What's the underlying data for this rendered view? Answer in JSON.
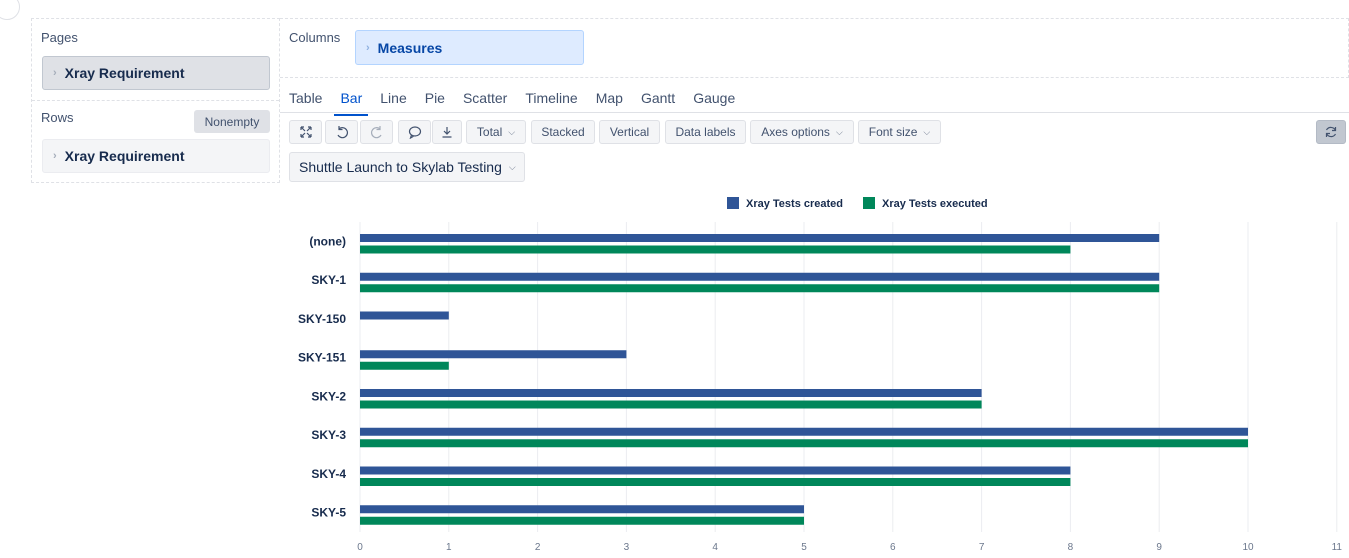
{
  "left_panel": {
    "pages_label": "Pages",
    "pages_pill": "Xray Requirement",
    "rows_label": "Rows",
    "nonempty_label": "Nonempty",
    "rows_pill": "Xray Requirement"
  },
  "columns_panel": {
    "label": "Columns",
    "pill": "Measures"
  },
  "tabs": [
    "Table",
    "Bar",
    "Line",
    "Pie",
    "Scatter",
    "Timeline",
    "Map",
    "Gantt",
    "Gauge"
  ],
  "active_tab": "Bar",
  "toolbar": {
    "total": "Total",
    "stacked": "Stacked",
    "vertical": "Vertical",
    "data_labels": "Data labels",
    "axes_options": "Axes options",
    "font_size": "Font size",
    "icons": [
      "expand-icon",
      "undo-icon",
      "redo-icon",
      "comment-icon",
      "download-icon",
      "refresh-icon"
    ]
  },
  "page_select": "Shuttle Launch to Skylab Testing",
  "colors": {
    "created": "#2f5597",
    "executed": "#00875a",
    "accent": "#0052cc"
  },
  "chart_data": {
    "type": "bar",
    "orientation": "horizontal",
    "categories": [
      "(none)",
      "SKY-1",
      "SKY-150",
      "SKY-151",
      "SKY-2",
      "SKY-3",
      "SKY-4",
      "SKY-5"
    ],
    "series": [
      {
        "name": "Xray Tests created",
        "values": [
          9,
          9,
          1,
          3,
          7,
          10,
          8,
          5
        ]
      },
      {
        "name": "Xray Tests executed",
        "values": [
          8,
          9,
          0,
          1,
          7,
          10,
          8,
          5
        ]
      }
    ],
    "xlim": [
      0,
      11
    ],
    "xticks": [
      0,
      1,
      2,
      3,
      4,
      5,
      6,
      7,
      8,
      9,
      10,
      11
    ],
    "grid": true,
    "legend_position": "top"
  }
}
